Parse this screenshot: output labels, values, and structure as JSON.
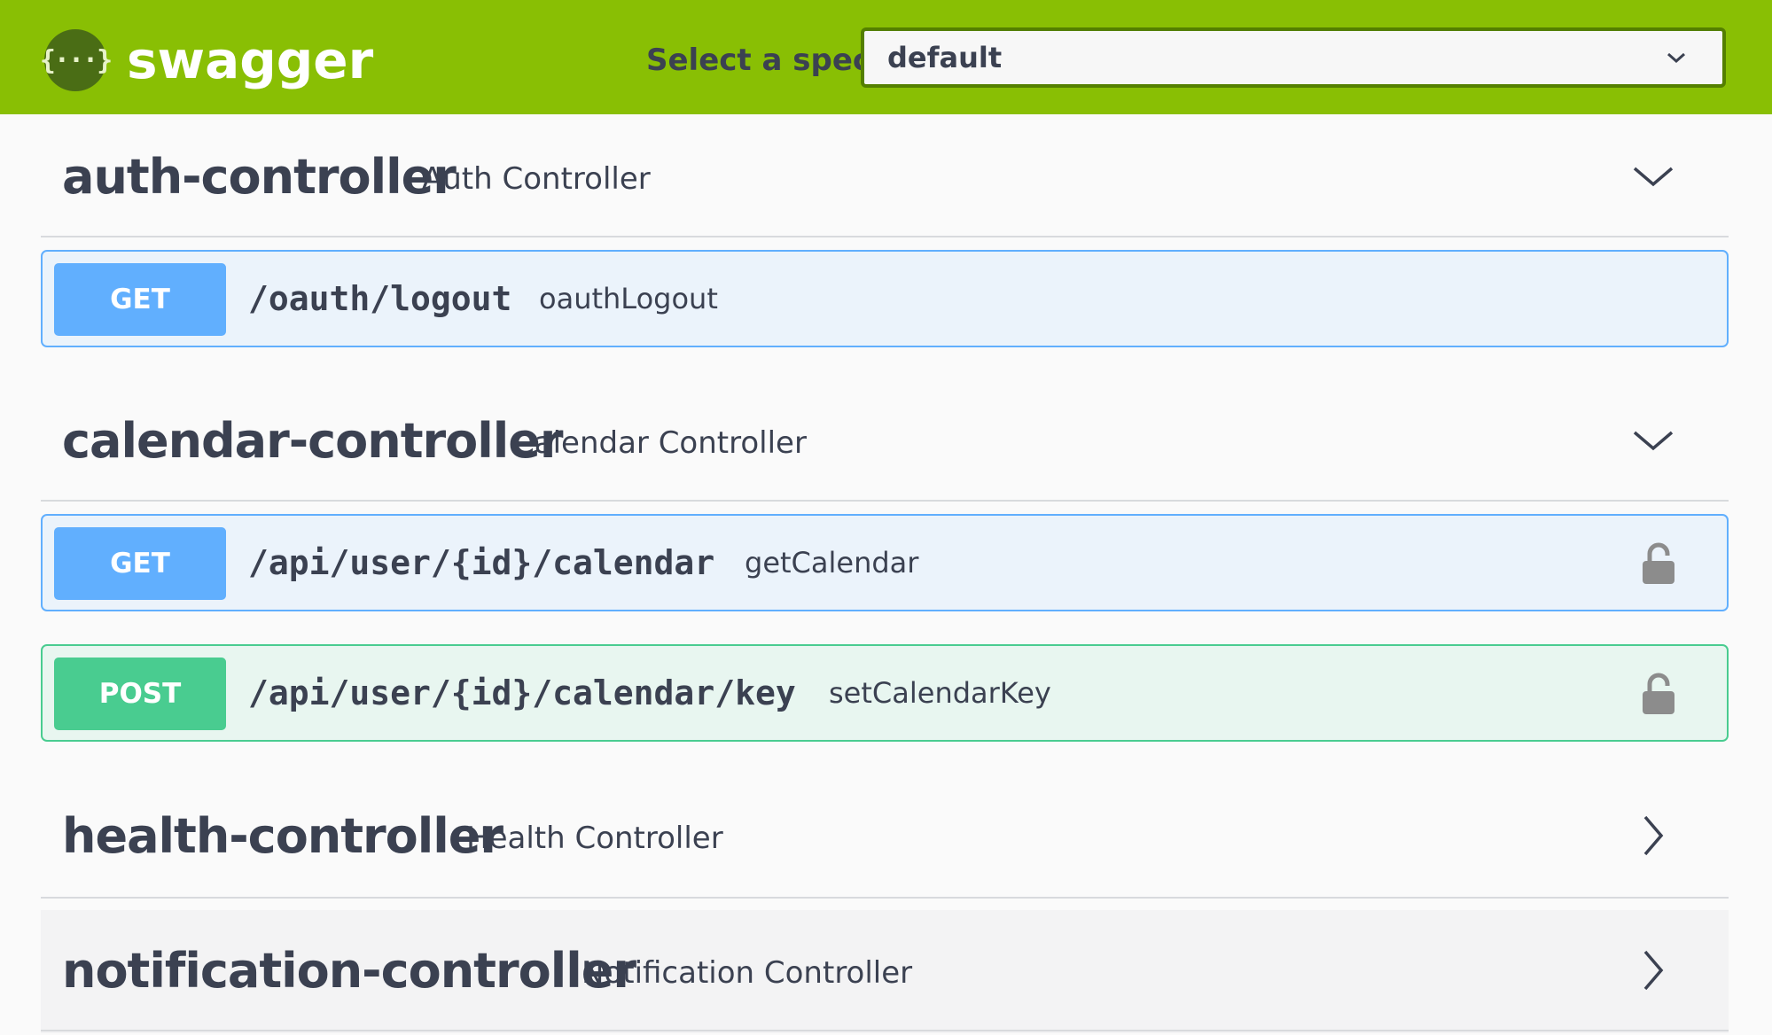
{
  "topbar": {
    "logo_glyph": "{···}",
    "brand": "swagger",
    "spec_label": "Select a spec",
    "spec_value": "default",
    "color": "#89bf04"
  },
  "controllers": [
    {
      "name": "auth-controller",
      "description": "Auth Controller",
      "expanded": true,
      "operations": [
        {
          "method": "GET",
          "path": "/oauth/logout",
          "operation_id": "oauthLogout",
          "locked": false
        }
      ]
    },
    {
      "name": "calendar-controller",
      "description": "Calendar Controller",
      "expanded": true,
      "operations": [
        {
          "method": "GET",
          "path": "/api/user/{id}/calendar",
          "operation_id": "getCalendar",
          "locked": true
        },
        {
          "method": "POST",
          "path": "/api/user/{id}/calendar/key",
          "operation_id": "setCalendarKey",
          "locked": true
        }
      ]
    },
    {
      "name": "health-controller",
      "description": "Health Controller",
      "expanded": false,
      "operations": []
    },
    {
      "name": "notification-controller",
      "description": "Notification Controller",
      "expanded": false,
      "operations": []
    }
  ],
  "colors": {
    "get": "#61affe",
    "post": "#49cc90",
    "text": "#3b4151"
  }
}
